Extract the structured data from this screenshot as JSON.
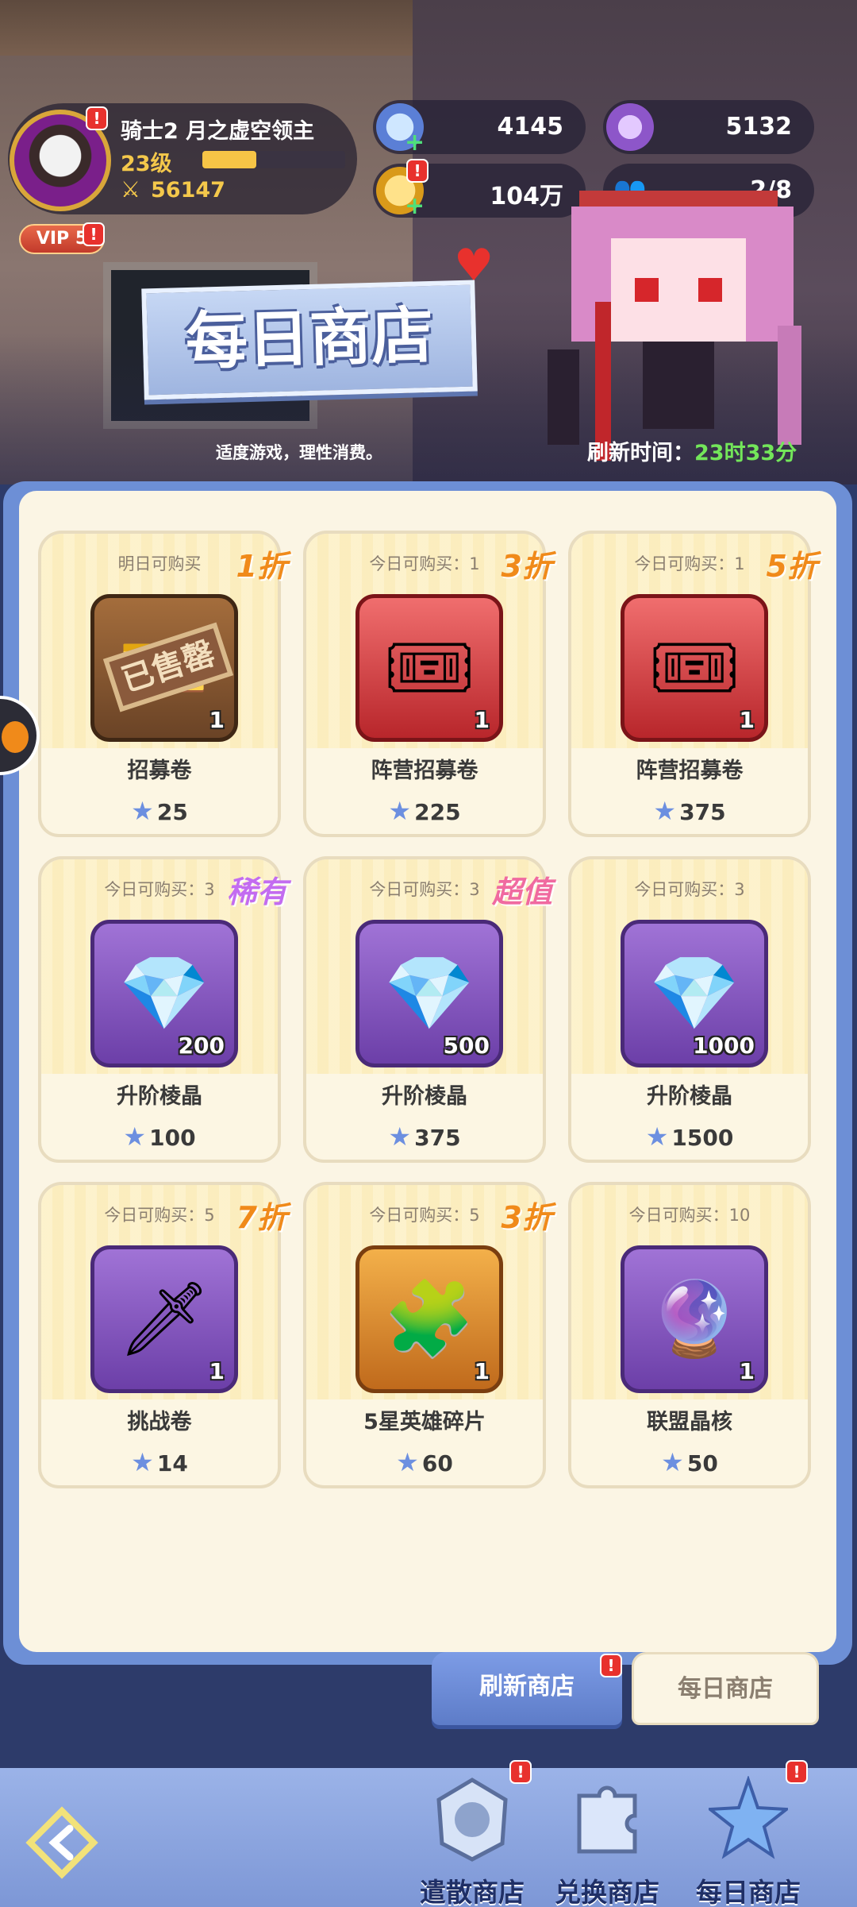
{
  "player": {
    "name": "骑士2 月之虚空领主",
    "level": "23级",
    "level_progress": 0.38,
    "power": "56147",
    "vip": "VIP 5"
  },
  "resources": {
    "star": "4145",
    "gem": "5132",
    "coin": "104万",
    "team": "2/8"
  },
  "shop": {
    "title": "每日商店",
    "hint": "适度游戏，理性消费。",
    "refresh_label": "刷新时间：",
    "refresh_time": "23时33分"
  },
  "items": [
    {
      "limit": "明日可购买",
      "discount": "1折",
      "name": "招募卷",
      "qty": "1",
      "price": "25",
      "sold_out": "已售罄"
    },
    {
      "limit": "今日可购买：1",
      "discount": "3折",
      "name": "阵营招募卷",
      "qty": "1",
      "price": "225"
    },
    {
      "limit": "今日可购买：1",
      "discount": "5折",
      "name": "阵营招募卷",
      "qty": "1",
      "price": "375"
    },
    {
      "limit": "今日可购买：3",
      "discount": "稀有",
      "name": "升阶棱晶",
      "qty": "200",
      "price": "100"
    },
    {
      "limit": "今日可购买：3",
      "discount": "超值",
      "name": "升阶棱晶",
      "qty": "500",
      "price": "375"
    },
    {
      "limit": "今日可购买：3",
      "discount": "",
      "name": "升阶棱晶",
      "qty": "1000",
      "price": "1500"
    },
    {
      "limit": "今日可购买：5",
      "discount": "7折",
      "name": "挑战卷",
      "qty": "1",
      "price": "14"
    },
    {
      "limit": "今日可购买：5",
      "discount": "3折",
      "name": "5星英雄碎片",
      "qty": "1",
      "price": "60"
    },
    {
      "limit": "今日可购买：10",
      "discount": "",
      "name": "联盟晶核",
      "qty": "1",
      "price": "50"
    }
  ],
  "tabs": {
    "refresh": "刷新商店",
    "daily": "每日商店"
  },
  "nav": [
    {
      "label": "遣散商店",
      "icon": "dismiss-shop-icon"
    },
    {
      "label": "兑换商店",
      "icon": "exchange-shop-icon"
    },
    {
      "label": "每日商店",
      "icon": "daily-shop-icon"
    }
  ],
  "alert_mark": "!"
}
